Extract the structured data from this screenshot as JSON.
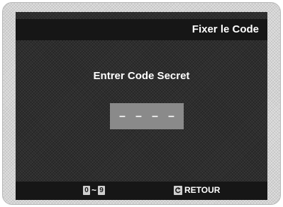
{
  "dialog": {
    "title": "Fixer le Code",
    "prompt": "Entrer Code Secret",
    "code_placeholder": [
      "–",
      "–",
      "–",
      "–"
    ]
  },
  "footer": {
    "key_from": "0",
    "key_separator": "~",
    "key_to": "9",
    "return_label": "RETOUR",
    "return_icon": "return-icon"
  }
}
